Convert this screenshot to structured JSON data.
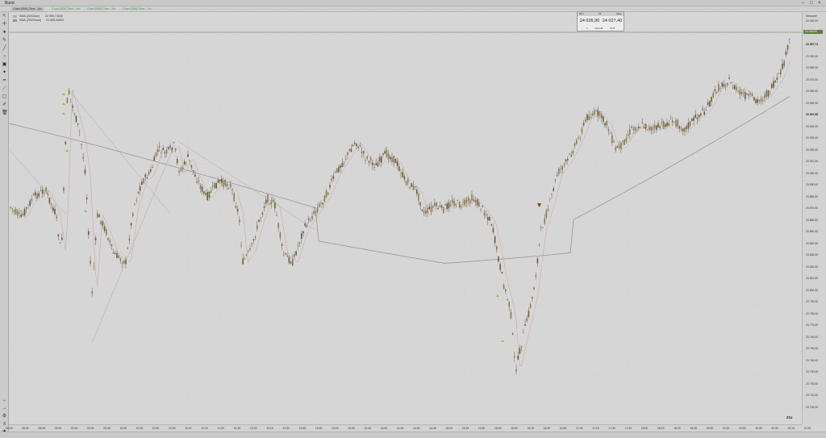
{
  "window": {
    "title": "Bund",
    "controls": [
      "–",
      "□",
      "×"
    ]
  },
  "tabs": [
    {
      "label": "Chart (SIM) Time - 3m",
      "active": true
    },
    {
      "label": "Chart (SIM) Time - 4m",
      "active": false
    },
    {
      "label": "Chart (SIM) Time - 5m",
      "active": false
    },
    {
      "label": "Chart (SIM) Time - 7m",
      "active": false
    }
  ],
  "toolbar": {
    "tools": [
      "cursor-icon",
      "crosshair-icon",
      "dot-icon",
      "pencil-icon",
      "line-icon",
      "circle-icon",
      "lock-icon",
      "pin-icon",
      "ruler-icon",
      "trend-icon",
      "rect-icon",
      "brush-icon",
      "trash-icon"
    ],
    "bottom_tools": [
      "arrow-left-icon",
      "arrow-right-icon",
      "settings-icon",
      "list-icon",
      "gear-icon"
    ]
  },
  "legend": {
    "items": [
      {
        "label": "SMA (20/Close)",
        "value": "22 999,71000",
        "color": "#e05a5a"
      },
      {
        "label": "SMA (200/Close)",
        "value": "22 899,94800",
        "color": "#888888"
      }
    ]
  },
  "order_box": {
    "header_left": "BUY",
    "header_mid": "MI",
    "header_right": "SELL",
    "bid": "24 026,90",
    "ask": "24 027,40",
    "footer": [
      "1",
      "Normal",
      "STD"
    ]
  },
  "current_price": "24 030,00",
  "price_axis": {
    "top_label": "Welcome",
    "labels": [
      "24 020,00",
      "24 010,00",
      "23 997,71",
      "23 990,00",
      "23 980,00",
      "23 970,00",
      "23 960,00",
      "23 950,00",
      "23 947,50",
      "23 940,00",
      "23 930,00",
      "23 920,00",
      "23 910,00",
      "23 900,00",
      "23 890,00",
      "23 880,00",
      "23 870,00",
      "23 860,00",
      "23 850,00",
      "23 840,00",
      "23 830,00",
      "23 820,00",
      "23 810,00",
      "23 800,00",
      "23 790,00",
      "23 780,00",
      "23 770,00",
      "23 760,00",
      "23 750,00",
      "23 740,00",
      "23 730,00",
      "23 720,00",
      "23 710,00",
      "23 700,00"
    ]
  },
  "time_axis": {
    "labels": [
      "08:15",
      "08:30",
      "08:45",
      "09:00",
      "09:15",
      "09:30",
      "09:45",
      "10:00",
      "10:15",
      "10:30",
      "10:45",
      "11:00",
      "11:15",
      "11:30",
      "11:45",
      "12:00",
      "12:15",
      "12:30",
      "12:45",
      "13:00",
      "13:15",
      "13:30",
      "13:45",
      "14:00",
      "14:15",
      "14:30",
      "14:45",
      "15:00",
      "15:15",
      "15:30",
      "15:45",
      "16:00",
      "16:15",
      "16:30",
      "16:45",
      "17:00",
      "17:15",
      "17:30",
      "17:45",
      "18:00",
      "18:15",
      "18:30",
      "18:45",
      "19:00",
      "19:15",
      "19:30",
      "19:45",
      "20:00",
      "20:15",
      "20:30"
    ]
  },
  "zoom_badge": "21x",
  "colors": {
    "up": "#8a7a4a",
    "down": "#6b5a35",
    "sma20": "#c8a0a0",
    "sma200": "#8e8e8e",
    "grid": "#e2b8b8",
    "accent": "#5f7d3a"
  }
}
